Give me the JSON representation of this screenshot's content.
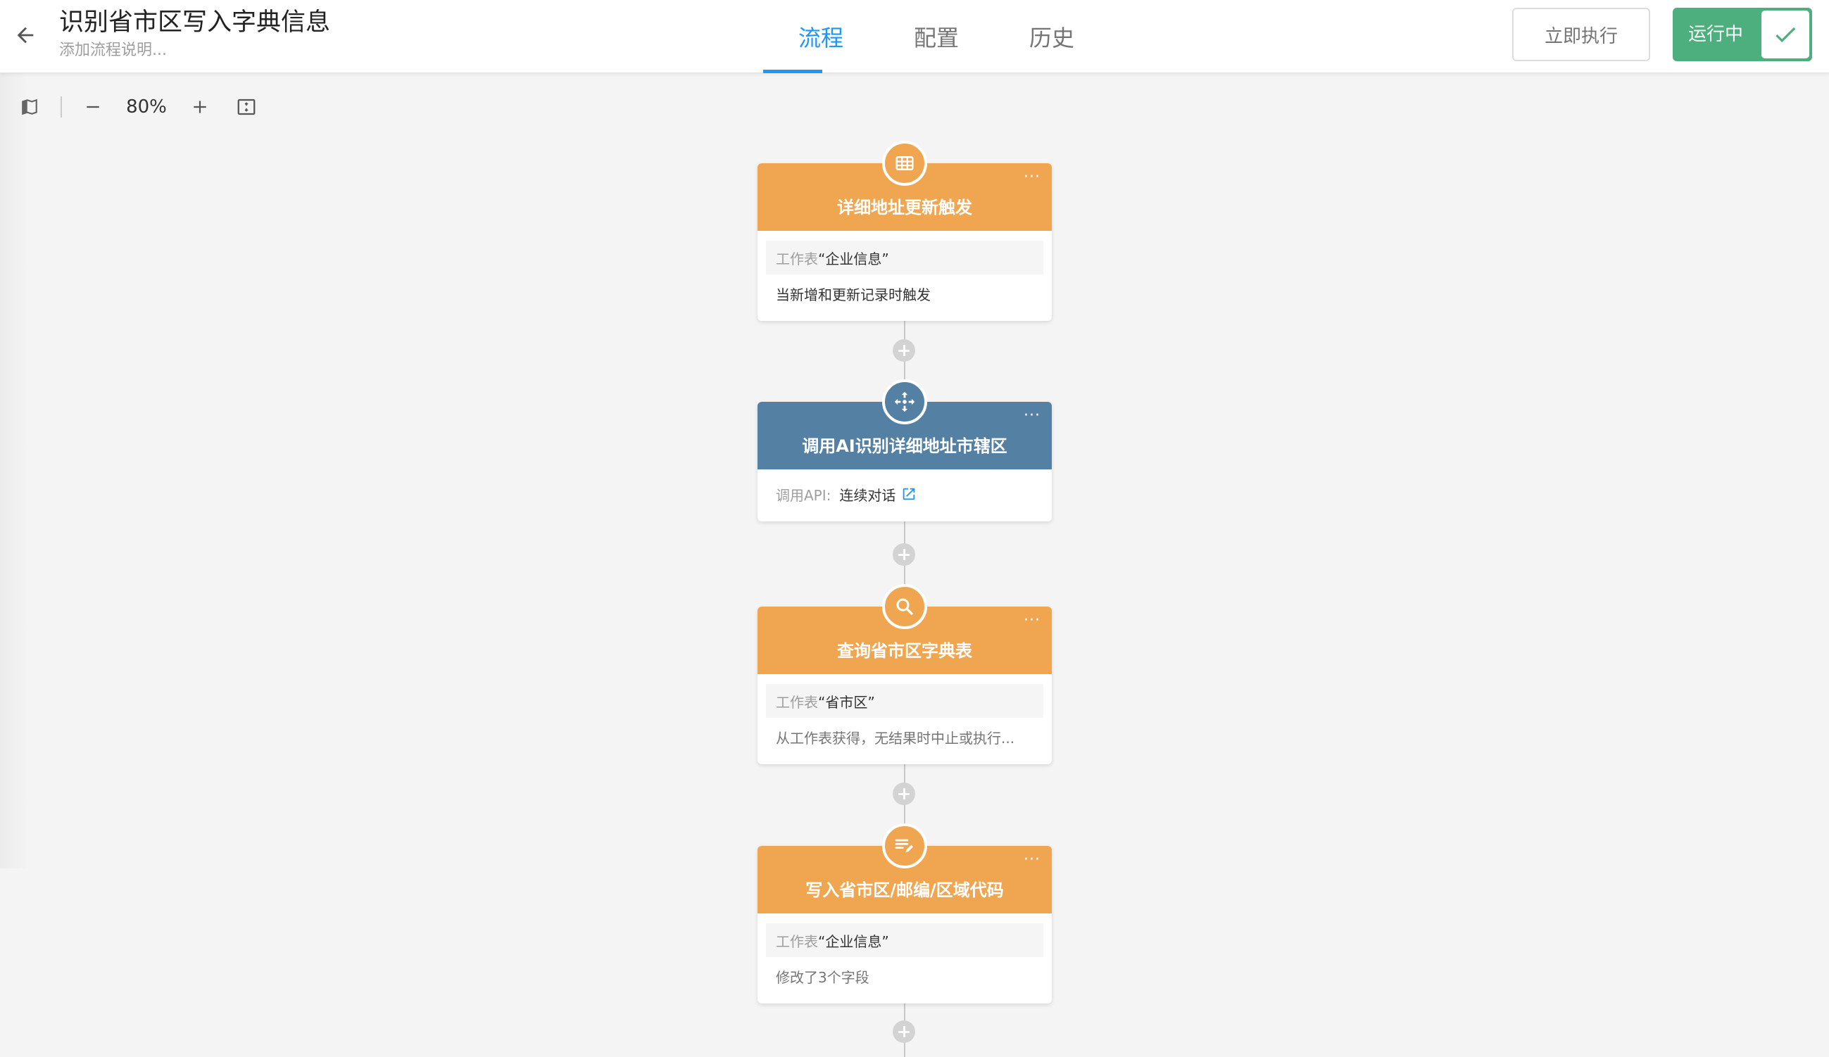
{
  "header": {
    "title": "识别省市区写入字典信息",
    "description_placeholder": "添加流程说明...",
    "tabs": [
      {
        "label": "流程",
        "active": true
      },
      {
        "label": "配置",
        "active": false
      },
      {
        "label": "历史",
        "active": false
      }
    ],
    "run_now_label": "立即执行",
    "status_label": "运行中",
    "status_on": true
  },
  "toolbar": {
    "zoom": "80%",
    "icons": [
      "map-icon",
      "zoom-out-icon",
      "zoom-in-icon",
      "fit-screen-icon"
    ]
  },
  "colors": {
    "accent": "#2196f3",
    "status_green": "#4caf7d",
    "node_orange": "#f0a650",
    "node_blue": "#5480a4"
  },
  "nodes": [
    {
      "title": "详细地址更新触发",
      "icon": "table-icon",
      "color": "orange",
      "rows": {
        "label": "工作表",
        "value": "“企业信息”",
        "detail": "当新增和更新记录时触发"
      }
    },
    {
      "title": "调用AI识别详细地址市辖区",
      "icon": "api-move-icon",
      "color": "blue",
      "rows": {
        "api_label": "调用API:",
        "api_value": "连续对话"
      }
    },
    {
      "title": "查询省市区字典表",
      "icon": "search-icon",
      "color": "orange",
      "rows": {
        "label": "工作表",
        "value": "“省市区”",
        "detail": "从工作表获得，无结果时中止或执行..."
      }
    },
    {
      "title": "写入省市区/邮编/区域代码",
      "icon": "edit-list-icon",
      "color": "orange",
      "rows": {
        "label": "工作表 ",
        "value": "“企业信息”",
        "detail": "修改了3个字段"
      }
    }
  ]
}
